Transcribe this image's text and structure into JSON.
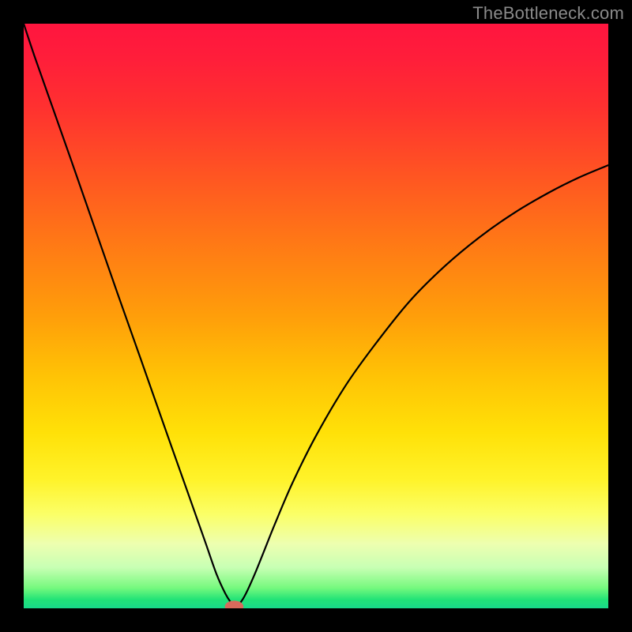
{
  "watermark": "TheBottleneck.com",
  "chart_data": {
    "type": "line",
    "title": "",
    "xlabel": "",
    "ylabel": "",
    "xlim": [
      0,
      100
    ],
    "ylim": [
      0,
      100
    ],
    "grid": false,
    "series": [
      {
        "name": "bottleneck-curve",
        "x": [
          0,
          2,
          5,
          8,
          12,
          16,
          20,
          24,
          28,
          31,
          33,
          34.5,
          35.5,
          36,
          37,
          38,
          39.5,
          41,
          43,
          46,
          50,
          55,
          60,
          66,
          72,
          78,
          84,
          90,
          95,
          100
        ],
        "values": [
          100,
          94,
          85.5,
          77,
          65.5,
          54,
          42.7,
          31.3,
          20,
          11.5,
          5.8,
          2.5,
          0.9,
          0.3,
          0.9,
          2.5,
          5.8,
          9.5,
          14.5,
          21.5,
          29.5,
          38,
          45,
          52.5,
          58.5,
          63.5,
          67.7,
          71.2,
          73.7,
          75.8
        ]
      }
    ],
    "marker": {
      "x": 36,
      "y": 0.3,
      "rx": 1.6,
      "ry": 1.0,
      "color": "#d86a5c"
    },
    "gradient_stops": [
      {
        "pct": 0,
        "color": "#ff153f"
      },
      {
        "pct": 50,
        "color": "#ff9e0a"
      },
      {
        "pct": 78,
        "color": "#fff32a"
      },
      {
        "pct": 100,
        "color": "#18d98a"
      }
    ]
  }
}
